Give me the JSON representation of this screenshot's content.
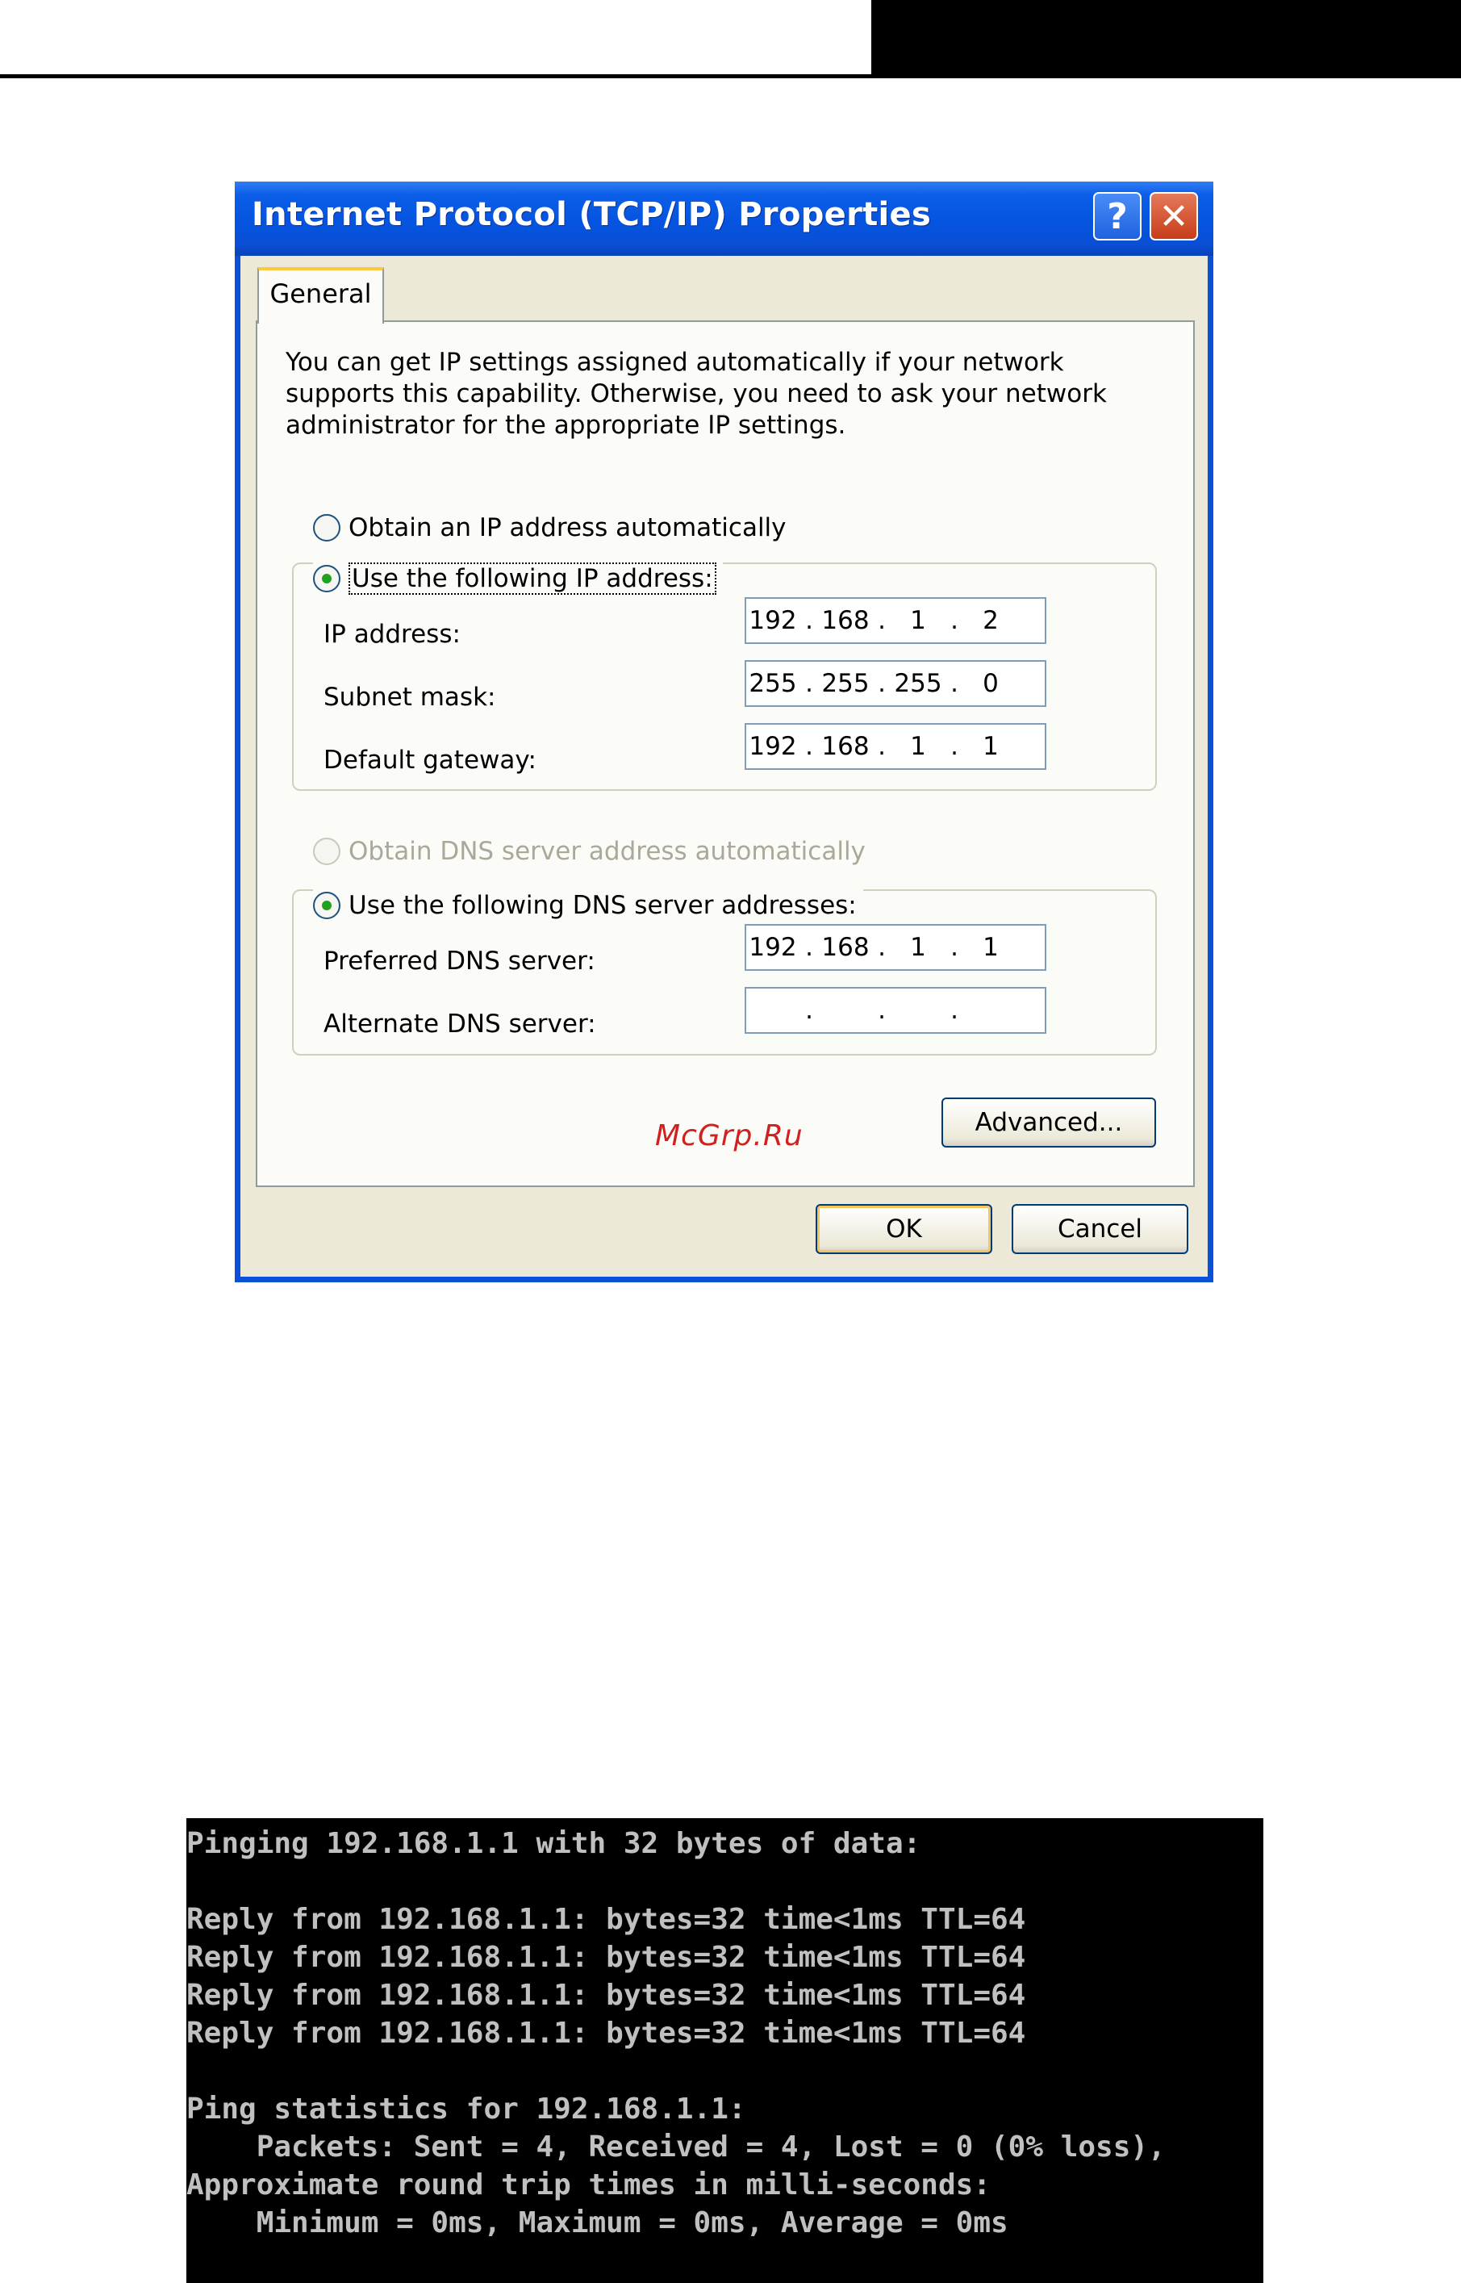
{
  "dialog": {
    "title": "Internet Protocol (TCP/IP) Properties",
    "help_label": "?",
    "close_label": "✕",
    "tab_label": "General",
    "description": "You can get IP settings assigned automatically if your network supports this capability. Otherwise, you need to ask your network administrator for the appropriate IP settings.",
    "ip_auto_label": "Obtain an IP address automatically",
    "ip_manual_label": "Use the following IP address:",
    "ip_label": "IP address:",
    "subnet_label": "Subnet mask:",
    "gateway_label": "Default gateway:",
    "ip_address": [
      "192",
      "168",
      "1",
      "2"
    ],
    "subnet_mask": [
      "255",
      "255",
      "255",
      "0"
    ],
    "default_gateway": [
      "192",
      "168",
      "1",
      "1"
    ],
    "dns_auto_label": "Obtain DNS server address automatically",
    "dns_manual_label": "Use the following DNS server addresses:",
    "preferred_dns_label": "Preferred DNS server:",
    "alternate_dns_label": "Alternate DNS server:",
    "preferred_dns": [
      "192",
      "168",
      "1",
      "1"
    ],
    "alternate_dns": [
      "",
      "",
      "",
      ""
    ],
    "advanced_label": "Advanced...",
    "ok_label": "OK",
    "cancel_label": "Cancel",
    "selected_ip_option": "manual",
    "selected_dns_option": "manual"
  },
  "watermark": "McGrp.Ru",
  "console": {
    "lines": [
      "Pinging 192.168.1.1 with 32 bytes of data:",
      "",
      "Reply from 192.168.1.1: bytes=32 time<1ms TTL=64",
      "Reply from 192.168.1.1: bytes=32 time<1ms TTL=64",
      "Reply from 192.168.1.1: bytes=32 time<1ms TTL=64",
      "Reply from 192.168.1.1: bytes=32 time<1ms TTL=64",
      "",
      "Ping statistics for 192.168.1.1:",
      "    Packets: Sent = 4, Received = 4, Lost = 0 (0% loss),",
      "Approximate round trip times in milli-seconds:",
      "    Minimum = 0ms, Maximum = 0ms, Average = 0ms"
    ]
  },
  "colors": {
    "titlebar": "#0554e0",
    "dialog_face": "#ece9d8",
    "console_bg": "#000000",
    "console_text": "#c0c0c0",
    "radio_selected": "#21a121",
    "watermark": "#d02020"
  }
}
